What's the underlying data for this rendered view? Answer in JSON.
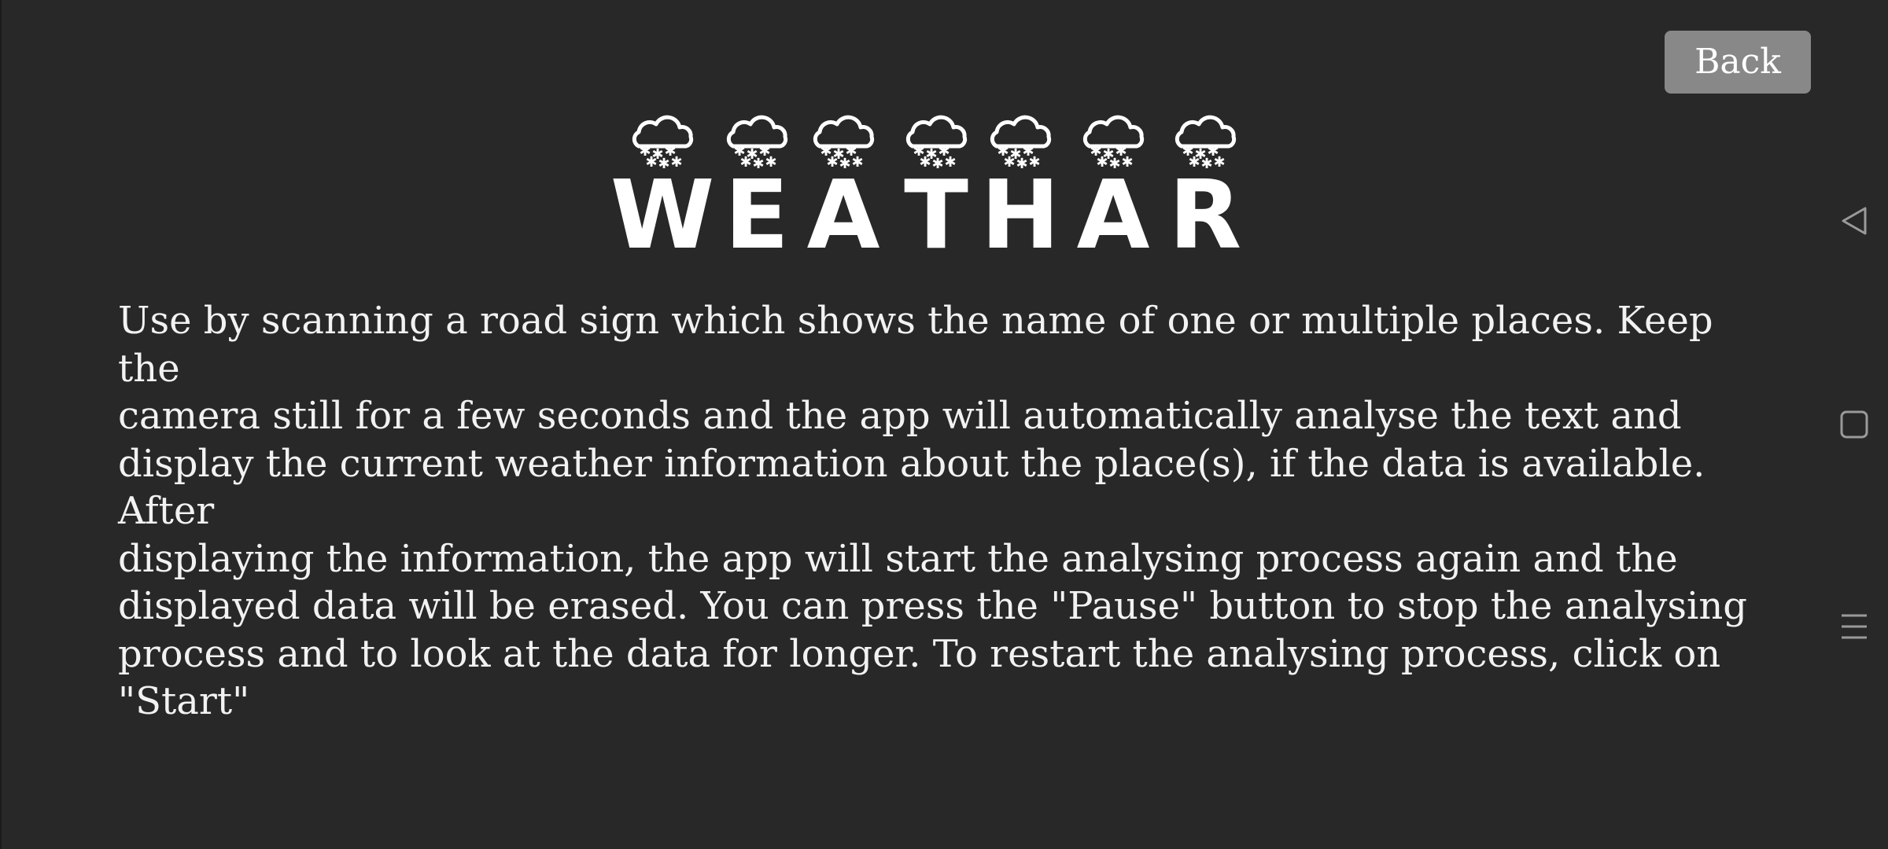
{
  "header": {
    "back_label": "Back",
    "logo_text": "WEATHAR",
    "logo_letters": [
      "W",
      "E",
      "A",
      "T",
      "H",
      "A",
      "R"
    ]
  },
  "main": {
    "description": "Use by scanning a road sign which shows the name of one or multiple places. Keep the\ncamera still for a few seconds and the app will automatically analyse the text and\ndisplay the current weather information about the place(s), if the data is available. After\ndisplaying the information, the app will start the analysing process again and the\ndisplayed data will be erased. You can press the \"Pause\" button to stop the analysing\nprocess and to look at the data for longer. To restart the analysing process, click on\n\"Start\""
  },
  "nav_bar": {
    "icons": [
      "back-triangle-icon",
      "recent-apps-square-icon",
      "menu-lines-icon"
    ]
  },
  "colors": {
    "background": "#282828",
    "button": "#888888",
    "text": "#f2f2f2",
    "nav_icon": "#9a9a9a"
  }
}
